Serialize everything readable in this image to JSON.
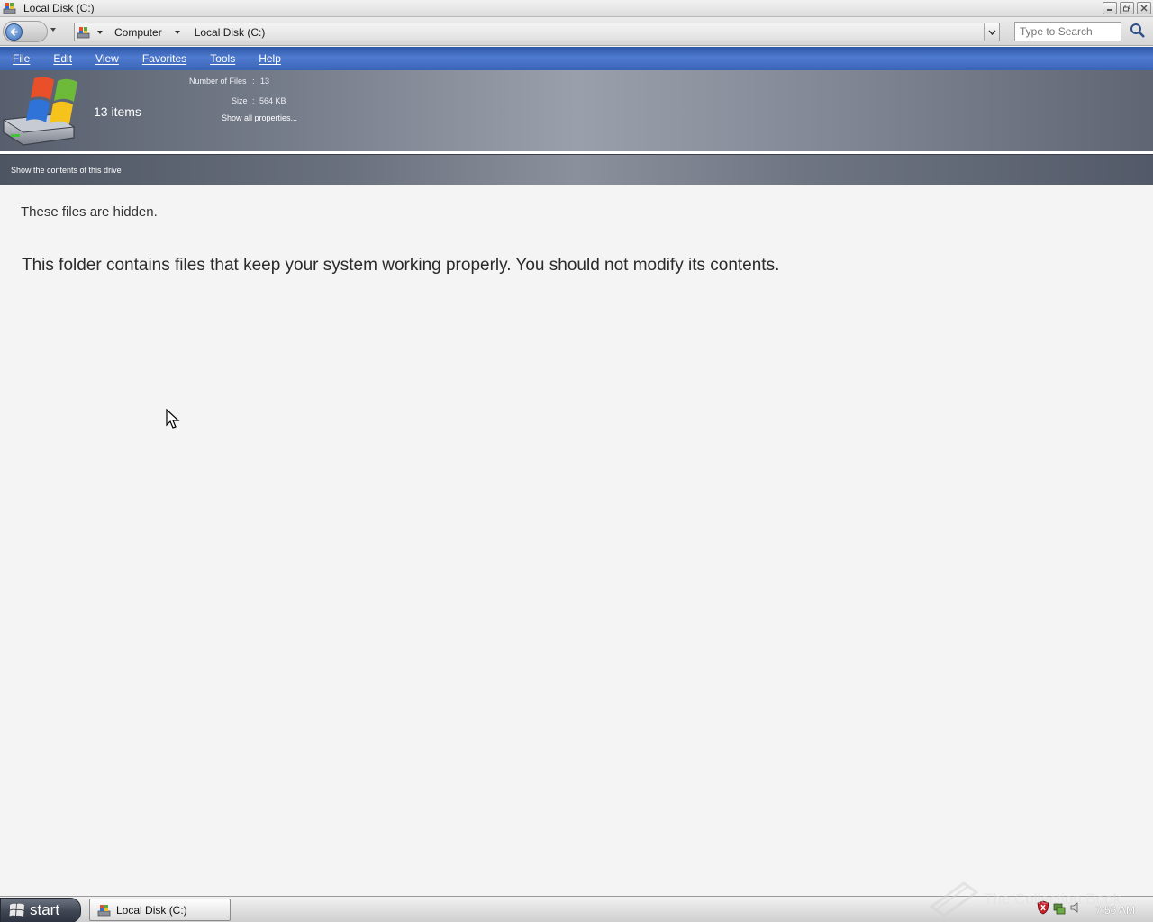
{
  "window": {
    "title": "Local Disk (C:)"
  },
  "address": {
    "crumbs": [
      "Computer",
      "Local Disk (C:)"
    ]
  },
  "search": {
    "placeholder": "Type to Search"
  },
  "menu": [
    "File",
    "Edit",
    "View",
    "Favorites",
    "Tools",
    "Help"
  ],
  "details": {
    "item_count": "13 items",
    "number_of_files_label": "Number of Files",
    "number_of_files_value": "13",
    "size_label": "Size",
    "size_value": "564 KB",
    "separator": ":",
    "show_all_properties": "Show all properties..."
  },
  "tasks": {
    "show_contents": "Show the contents of this drive"
  },
  "content": {
    "hidden_title": "These files are hidden.",
    "warning": "This folder contains files that keep your system working properly. You should not modify its contents."
  },
  "taskbar": {
    "start_label": "start",
    "window_button": "Local Disk (C:)",
    "clock": "7:56 AM",
    "watermark": "The Collection Book"
  },
  "colors": {
    "menubar": "#3a64b6",
    "header_gradient_mid": "#9aa0ab",
    "content_bg": "#f4f4f4"
  },
  "icons": {
    "title": "drive-icon",
    "back": "back-arrow-icon",
    "search": "magnifier-icon",
    "tray": [
      "shield-icon",
      "network-icon",
      "speaker-icon"
    ]
  }
}
